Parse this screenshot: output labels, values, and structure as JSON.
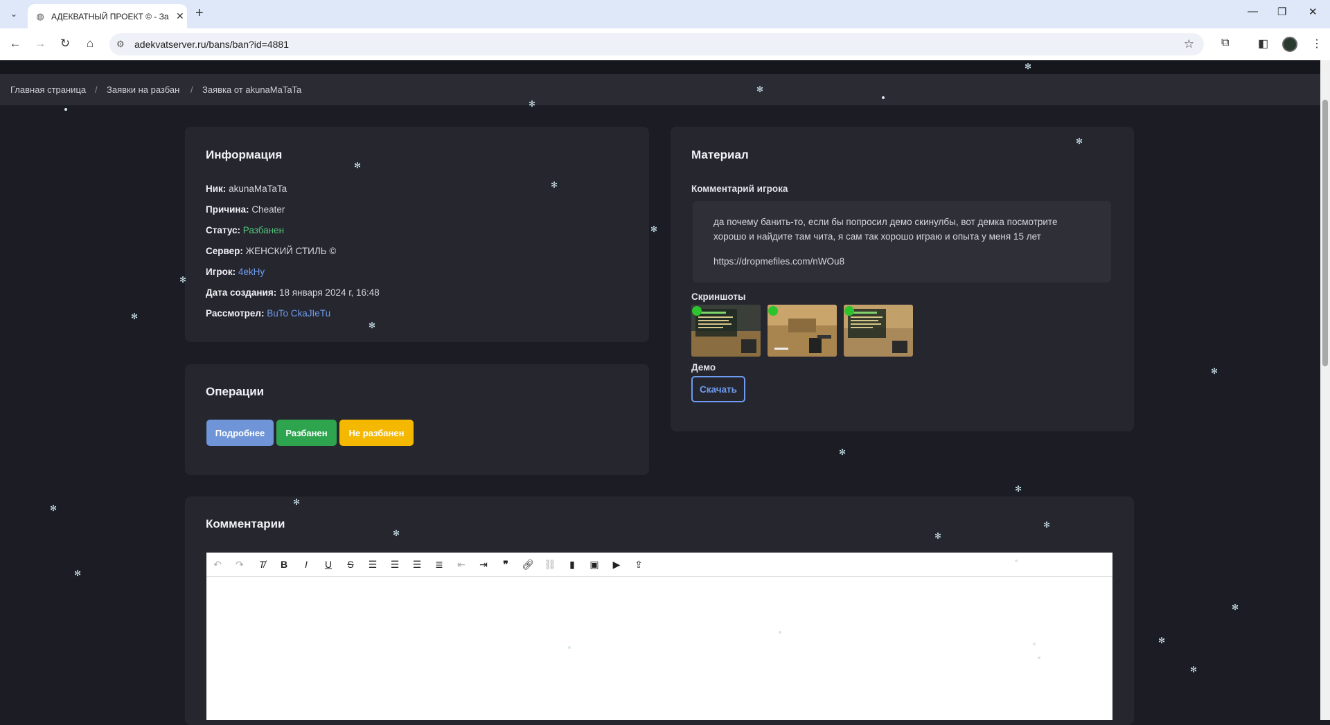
{
  "browser": {
    "tab_title": "АДЕКВАТНЫЙ ПРОЕКТ © - За",
    "url": "adekvatserver.ru/bans/ban?id=4881"
  },
  "breadcrumbs": [
    {
      "label": "Главная страница"
    },
    {
      "label": "Заявки на разбан"
    },
    {
      "label": "Заявка от akunaMaTaTa"
    }
  ],
  "info": {
    "title": "Информация",
    "rows": [
      {
        "key": "Ник:",
        "value": "akunaMaTaTa"
      },
      {
        "key": "Причина:",
        "value": "Cheater"
      },
      {
        "key": "Статус:",
        "value": "Разбанен"
      },
      {
        "key": "Сервер:",
        "value": "ЖЕНСКИЙ СТИЛЬ ©"
      },
      {
        "key": "Игрок:",
        "value": "4ekHy"
      },
      {
        "key": "Дата создания:",
        "value": "18 января 2024 г, 16:48"
      },
      {
        "key": "Рассмотрел:",
        "value": "BuTo CkaJIeTu"
      }
    ]
  },
  "operations": {
    "title": "Операции",
    "buttons": [
      {
        "label": "Подробнее",
        "color": "#6f95d8"
      },
      {
        "label": "Разбанен",
        "color": "#2ea44f"
      },
      {
        "label": "Не разбанен",
        "color": "#f5b800"
      }
    ]
  },
  "material": {
    "title": "Материал",
    "comment_label": "Комментарий игрока",
    "comment_text": "да почему банить-то, если бы попросил демо скинулбы, вот демка посмотрите хорошо и найдите там чита, я сам так хорошо играю и опыта у меня 15 лет",
    "comment_link": "https://dropmefiles.com/nWOu8",
    "screenshots_label": "Скриншоты",
    "demo_label": "Демо",
    "download_label": "Скачать"
  },
  "comments": {
    "title": "Комментарии",
    "toolbar": [
      "undo-icon",
      "redo-icon",
      "clear-format-icon",
      "bold-icon",
      "italic-icon",
      "underline-icon",
      "strikethrough-icon",
      "align-left-icon",
      "align-center-icon",
      "align-right-icon",
      "align-justify-icon",
      "outdent-icon",
      "indent-icon",
      "blockquote-icon",
      "link-icon",
      "unlink-icon",
      "bookmark-icon",
      "image-icon",
      "video-icon",
      "upload-icon"
    ]
  },
  "colors": {
    "page_bg": "#1c1d24",
    "card_bg": "#25262e",
    "accent_link": "#6f9cf0",
    "status_green": "#52c47a"
  }
}
